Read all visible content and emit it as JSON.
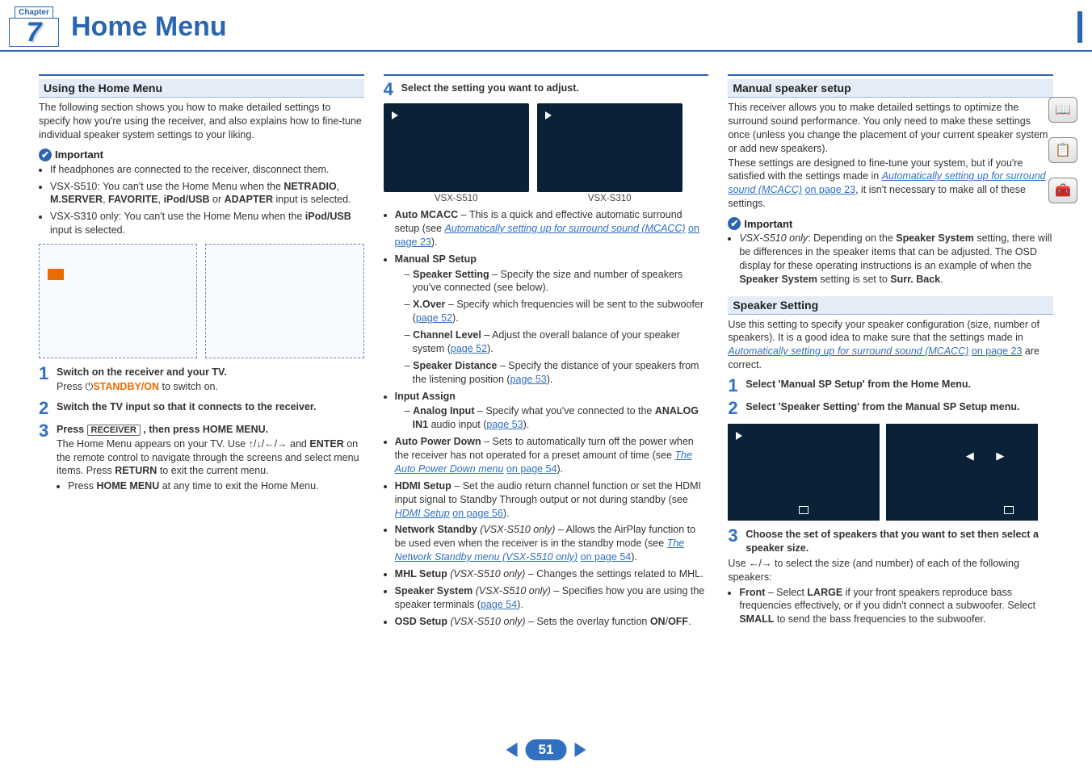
{
  "chapter": {
    "label": "Chapter",
    "number": "7"
  },
  "pageTitle": "Home Menu",
  "pageNumber": "51",
  "sideIcons": [
    "📖",
    "📋",
    "🧰"
  ],
  "col1": {
    "h2": "Using the Home Menu",
    "intro": "The following section shows you how to make detailed settings to specify how you're using the receiver, and also explains how to fine-tune individual speaker system settings to your liking.",
    "importantLabel": "Important",
    "importantItems": [
      "If headphones are connected to the receiver, disconnect them.",
      "VSX-S510: You can't use the Home Menu when the <b>NETRADIO</b>, <b>M.SERVER</b>, <b>FAVORITE</b>, <b>iPod/USB</b> or <b>ADAPTER</b> input is selected.",
      "VSX-S310 only: You can't use the Home Menu when the <b>iPod/USB</b> input is selected."
    ],
    "step1": {
      "num": "1",
      "title": "Switch on the receiver and your TV.",
      "body": "Press ⏻<span class='standby'>STANDBY/ON</span> to switch on."
    },
    "step2": {
      "num": "2",
      "title": "Switch the TV input so that it connects to the receiver."
    },
    "step3": {
      "num": "3",
      "title": "Press <span class='key-label'>RECEIVER</span> , then press HOME MENU.",
      "body": "The Home Menu appears on your TV. Use ↑/↓/←/→ and <b>ENTER</b> on the remote control to navigate through the screens and select menu items. Press <b>RETURN</b> to exit the current menu."
    },
    "step3bullet": "Press <b>HOME MENU</b> at any time to exit the Home Menu."
  },
  "col2": {
    "step4": {
      "num": "4",
      "title": "Select the setting you want to adjust."
    },
    "screenCaps": [
      "VSX-S510",
      "VSX-S310"
    ],
    "bullets": [
      {
        "label": "Auto MCACC",
        "text": " – This is a quick and effective automatic surround setup (see <span class='link'>Automatically setting up for surround sound (MCACC)</span> <span class='link-plain'>on page 23</span>)."
      },
      {
        "label": "Manual SP Setup",
        "sub": [
          "<b>Speaker Setting</b> – Specify the size and number of speakers you've connected (see below).",
          "<b>X.Over</b> – Specify which frequencies will be sent to the subwoofer (<span class='link-plain'>page 52</span>).",
          "<b>Channel Level</b> – Adjust the overall balance of your speaker system (<span class='link-plain'>page 52</span>).",
          "<b>Speaker Distance</b> – Specify the distance of your speakers from the listening position (<span class='link-plain'>page 53</span>)."
        ]
      },
      {
        "label": "Input Assign",
        "sub": [
          "<b>Analog Input</b> – Specify what you've connected to the <b>ANALOG IN1</b> audio input (<span class='link-plain'>page 53</span>)."
        ]
      },
      {
        "label": "Auto Power Down",
        "text": " – Sets to automatically turn off the power when the receiver has not operated for a preset amount of time (see <span class='link'>The Auto Power Down menu</span> <span class='link-plain'>on page 54</span>)."
      },
      {
        "label": "HDMI Setup",
        "text": " – Set the audio return channel function or set the HDMI input signal to Standby Through output or not during standby (see <span class='link'>HDMI Setup</span> <span class='link-plain'>on page 56</span>)."
      },
      {
        "label": "Network Standby",
        "text": " <i>(VSX-S510 only)</i> – Allows the AirPlay function to be used even when the receiver is in the standby mode (see <span class='link'>The Network Standby menu (VSX-S510 only)</span> <span class='link-plain'>on page 54</span>)."
      },
      {
        "label": "MHL Setup",
        "text": " <i>(VSX-S510 only)</i> – Changes the settings related to MHL."
      },
      {
        "label": "Speaker System",
        "text": " <i>(VSX-S510 only)</i> – Specifies how you are using the speaker terminals (<span class='link-plain'>page 54</span>)."
      },
      {
        "label": "OSD Setup",
        "text": " <i>(VSX-S510 only)</i> – Sets the overlay function <b>ON</b>/<b>OFF</b>."
      }
    ]
  },
  "col3": {
    "h2": "Manual speaker setup",
    "intro1": "This receiver allows you to make detailed settings to optimize the surround sound performance. You only need to make these settings once (unless you change the placement of your current speaker system or add new speakers).",
    "intro2": "These settings are designed to fine-tune your system, but if you're satisfied with the settings made in <span class='link'>Automatically setting up for surround sound (MCACC)</span> <span class='link-plain'>on page 23</span>, it isn't necessary to make all of these settings.",
    "importantLabel": "Important",
    "importantItem": "<i>VSX-S510 only</i>: Depending on the <b>Speaker System</b> setting, there will be differences in the speaker items that can be adjusted. The OSD display for these operating instructions is an example of when the <b>Speaker System</b> setting is set to <b>Surr. Back</b>.",
    "h2b": "Speaker Setting",
    "body2": "Use this setting to specify your speaker configuration (size, number of speakers). It is a good idea to make sure that the settings made in <span class='link'>Automatically setting up for surround sound (MCACC)</span> <span class='link-plain'>on page 23</span> are correct.",
    "step1": {
      "num": "1",
      "title": "Select 'Manual SP Setup' from the Home Menu."
    },
    "step2": {
      "num": "2",
      "title": "Select 'Speaker Setting' from the Manual SP Setup menu."
    },
    "step3": {
      "num": "3",
      "title": "Choose the set of speakers that you want to set then select a speaker size."
    },
    "step3text": "Use ←/→ to select the size (and number) of each of the following speakers:",
    "frontBullet": "<b>Front</b> – Select <b>LARGE</b> if your front speakers reproduce bass frequencies effectively, or if you didn't connect a subwoofer. Select <b>SMALL</b> to send the bass frequencies to the subwoofer."
  }
}
